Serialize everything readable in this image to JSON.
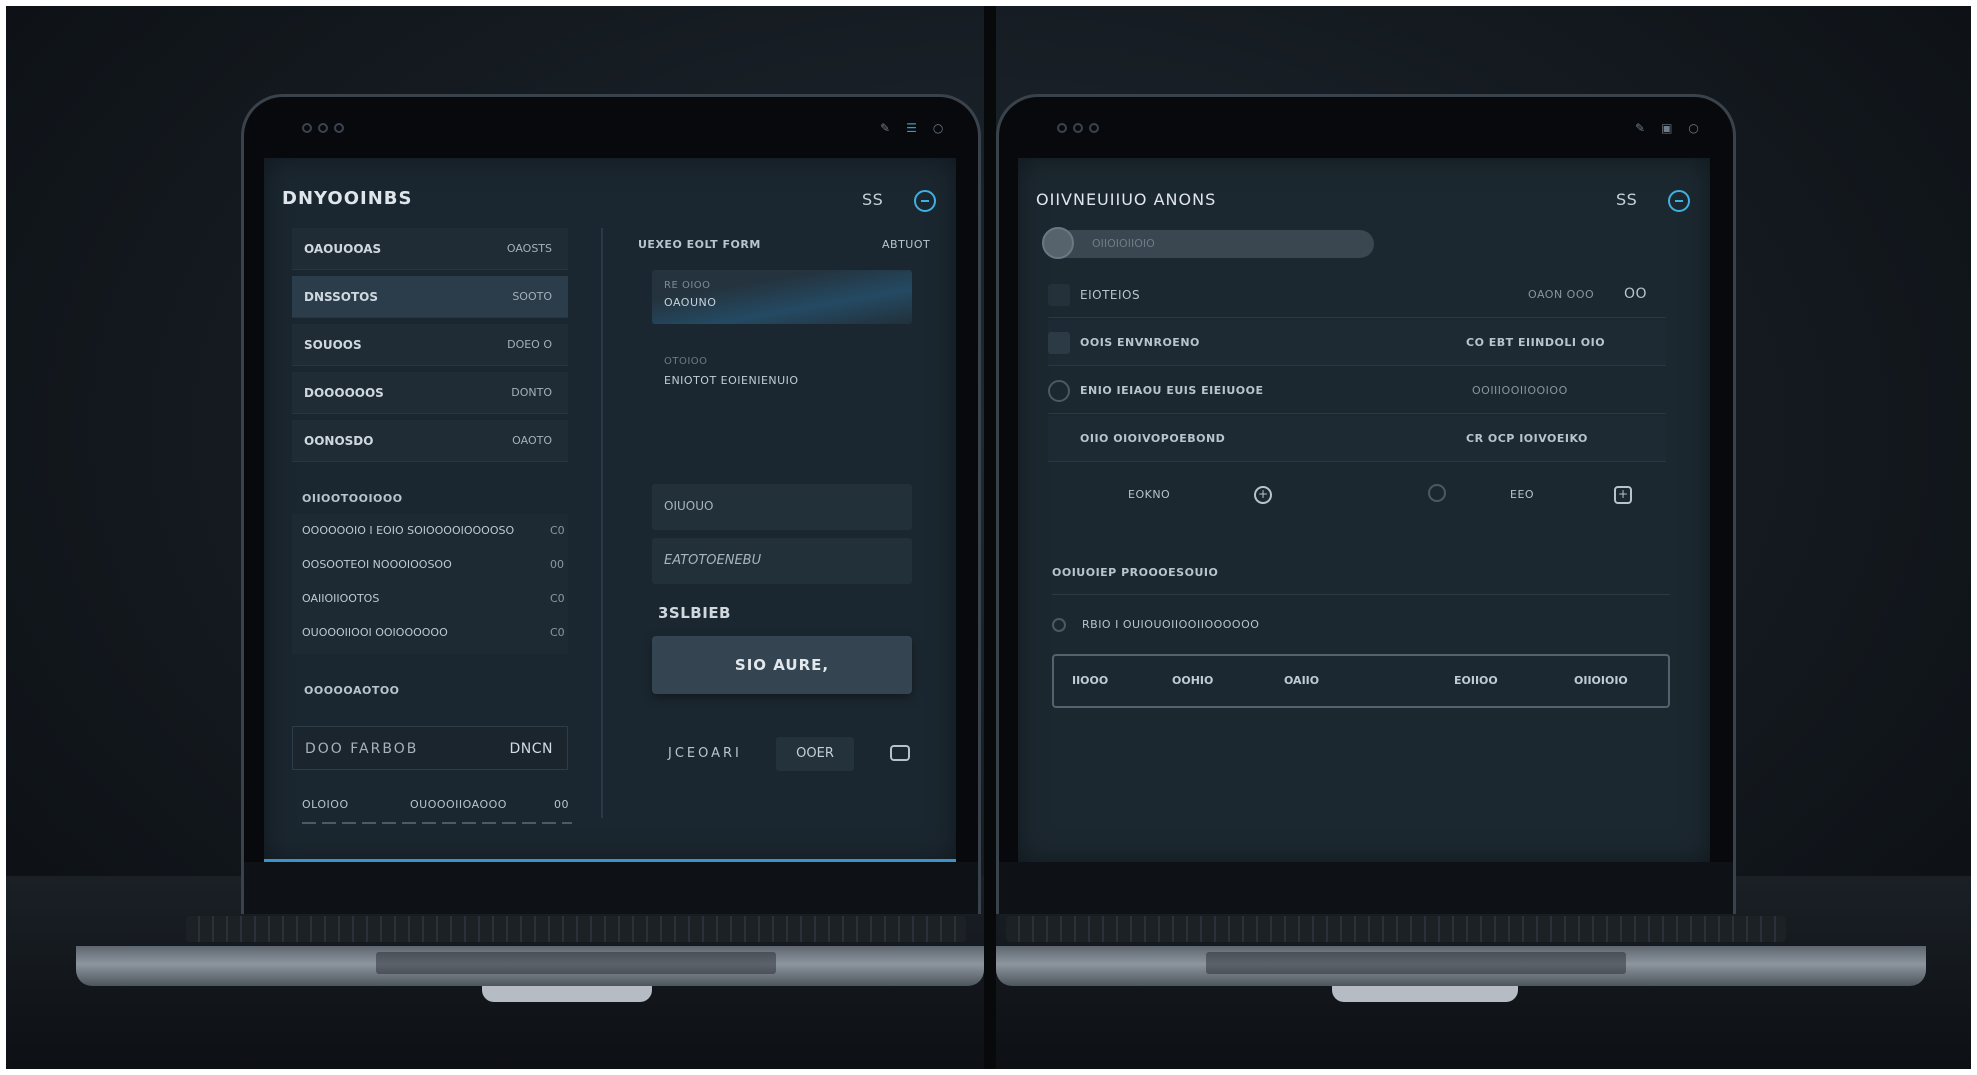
{
  "left_laptop": {
    "title": "DNYOOINBS",
    "top_right_label": "SS",
    "list_rows": [
      {
        "label": "OAOUOOAS",
        "value": "OAOSTS"
      },
      {
        "label": "DNSSOTOS",
        "value": "SOOTO"
      },
      {
        "label": "SOUOOS",
        "value": "DOEO O"
      },
      {
        "label": "DOOOOOOS",
        "value": "DONTO"
      },
      {
        "label": "OONOSDO",
        "value": "OAOTO"
      }
    ],
    "section_label": "OIIOOTOOIOOO",
    "sub_items": [
      {
        "label": "OOOOOOIO I EOIO SOIOOOOIOOOOSO",
        "count": "C0"
      },
      {
        "label": "OOSOOTEOI NOOOIOOSOO",
        "count": "00"
      },
      {
        "label": "OAIIOIIOOTOS",
        "count": "C0"
      },
      {
        "label": "OUOOOIIOOI OOIOOOOOO",
        "count": "C0"
      }
    ],
    "lower_label": "OOOOOAOTOO",
    "input_value": "DOO  FARBOB",
    "input_action": "DNCN",
    "footer_left": "OLOIOO",
    "footer_mid": "OUOOOIIOAOOO",
    "footer_count": "00",
    "right_header": "UEXEO EOLT FORM",
    "right_header_value": "ABTUOT",
    "field1_caption": "RE OIOO",
    "field1_value": "OAOUNO",
    "field2_caption": "OTOIOO",
    "field2_value": "ENIOTOT EOIENIENUIO",
    "card1": "OIUOUO",
    "card2": "EATOTOENEBU",
    "section_value": "3SLBIEB",
    "big_button": "SIO AURE,",
    "bottom_left": "JCEOARI",
    "bottom_button": "OOER"
  },
  "right_laptop": {
    "title": "OIIVNEUIIUO  ANONS",
    "top_right_label": "SS",
    "search_placeholder": "OIIOIOIIOIO",
    "rows": [
      {
        "label": "EIOTEIOS",
        "value": "OAON OOO",
        "trailing": "OO"
      },
      {
        "label": "OOIS ENVNROENO",
        "value": "CO EBT EIINDOLI  OIO",
        "trailing": ""
      },
      {
        "label": "ENIO  IEIAOU EUIS EIEIUOOE",
        "value": "OOIIIOOIIOOIOO",
        "trailing": ""
      },
      {
        "label": "OIIO  OIOIVOPOEBOND",
        "value": "CR OCP IOIVOEIKO",
        "trailing": ""
      }
    ],
    "toolbar": {
      "left_label": "EOKNO",
      "right_label": "EEO"
    },
    "section_label": "OOIUOIEP PROOOESOUIO",
    "sub_item": "RBIO I  OUIOUOIIOOIIOOOOOO",
    "table_headers": [
      "IIOOO",
      "OOHIO",
      "OAIIO",
      "EOIIOO",
      "OIIOIOIO"
    ]
  },
  "colors": {
    "accent": "#3fb0e0",
    "screen_bg": "#1b2730",
    "backdrop": "#141a20"
  },
  "icons": {
    "left_topbar": [
      "camera-dots",
      "pen-icon",
      "bars-icon",
      "circle-icon"
    ],
    "right_topbar": [
      "camera-dots",
      "pen-icon",
      "window-icon",
      "circle-icon"
    ]
  }
}
